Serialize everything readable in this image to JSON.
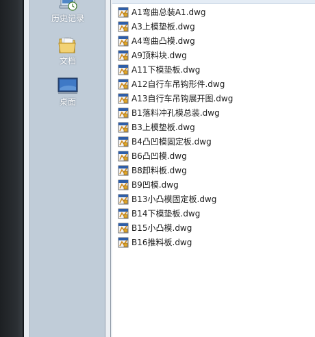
{
  "places": [
    {
      "label": "历史记录",
      "icon": "history-icon"
    },
    {
      "label": "文档",
      "icon": "documents-folder-icon"
    },
    {
      "label": "桌面",
      "icon": "desktop-icon"
    }
  ],
  "files": [
    {
      "name": "A1弯曲总装A1.dwg",
      "icon": "dwg-file-icon"
    },
    {
      "name": "A3上模垫板.dwg",
      "icon": "dwg-file-icon"
    },
    {
      "name": "A4弯曲凸模.dwg",
      "icon": "dwg-file-icon"
    },
    {
      "name": "A9顶料块.dwg",
      "icon": "dwg-file-icon"
    },
    {
      "name": "A11下模垫板.dwg",
      "icon": "dwg-file-icon"
    },
    {
      "name": "A12自行车吊钩形件.dwg",
      "icon": "dwg-file-icon"
    },
    {
      "name": "A13自行车吊钩展开图.dwg",
      "icon": "dwg-file-icon"
    },
    {
      "name": "B1落料冲孔模总装.dwg",
      "icon": "dwg-file-icon"
    },
    {
      "name": "B3上模垫板.dwg",
      "icon": "dwg-file-icon"
    },
    {
      "name": "B4凸凹模固定板.dwg",
      "icon": "dwg-file-icon"
    },
    {
      "name": "B6凸凹模.dwg",
      "icon": "dwg-file-icon"
    },
    {
      "name": "B8卸料板.dwg",
      "icon": "dwg-file-icon"
    },
    {
      "name": "B9凹模.dwg",
      "icon": "dwg-file-icon"
    },
    {
      "name": "B13小凸模固定板.dwg",
      "icon": "dwg-file-icon"
    },
    {
      "name": "B14下模垫板.dwg",
      "icon": "dwg-file-icon"
    },
    {
      "name": "B15小凸模.dwg",
      "icon": "dwg-file-icon"
    },
    {
      "name": "B16推料板.dwg",
      "icon": "dwg-file-icon"
    }
  ]
}
